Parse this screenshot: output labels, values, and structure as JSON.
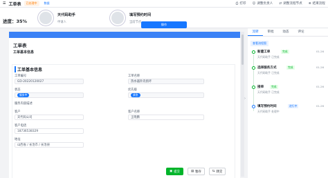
{
  "topbar": {
    "title": "工单表",
    "status_badge": "已处理中",
    "link": "数据",
    "actions": [
      "打印",
      "调整负责人",
      "调整流程节点",
      "结束流程"
    ]
  },
  "summary": {
    "progress": "进度：35%",
    "persons": [
      {
        "name": "天代码助手",
        "sub": "申请人"
      },
      {
        "name": "填写预约时间",
        "sub": "当前节点"
      }
    ],
    "step_button": "操作"
  },
  "form": {
    "title": "工单表",
    "subtitle": "工单基本信息",
    "section_title": "工单基本信息",
    "fields": {
      "ticket_no_label": "工单编号",
      "ticket_no_value": "GD-20220120027",
      "ticket_name_label": "工单名称",
      "ticket_name_value": "热水器外壳损坏",
      "status_label": "状态",
      "status_value": "服务中",
      "priority_label": "优先级",
      "priority_value": "紧急",
      "content_label": "服务内容描述",
      "customer_label": "客户",
      "customer_value": "天代码公司",
      "customer_name_label": "客户名称",
      "customer_name_value": "王晓鹏",
      "phone_label": "客户电话",
      "phone_value": "18736538329",
      "address_label": "地址",
      "address_value": "山西省 / 长治市 / 长治县"
    }
  },
  "right_panel": {
    "tabs": [
      "流转",
      "审批",
      "动态",
      "评论"
    ],
    "active_tab": "流转",
    "flow_chip": "查看流程图",
    "timeline": [
      {
        "name": "新建工单",
        "tag": "完成",
        "sub": "天代码助手 已完成",
        "date": "01-26"
      },
      {
        "name": "选择服务方式",
        "tag": "完成",
        "sub": "天代码助手 已完成",
        "date": "01-26"
      },
      {
        "name": "接单",
        "tag": "完成",
        "sub": "天代码助手 已完成",
        "date": "01-26"
      },
      {
        "name": "填写预约时间",
        "tag": "进行中",
        "sub": "天代码助手 处理中",
        "date": "01-26"
      }
    ]
  },
  "actions": {
    "submit": "提交",
    "save": "暂存",
    "transfer": "转交"
  }
}
